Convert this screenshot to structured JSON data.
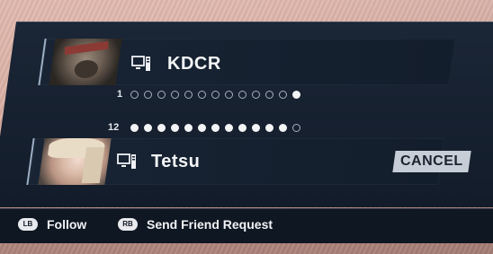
{
  "players": [
    {
      "name": "KDCR",
      "slot_number": "1",
      "avatar": "bear-character"
    },
    {
      "name": "Tetsu",
      "slot_number": "12",
      "avatar": "blonde-character"
    }
  ],
  "progress": {
    "top": {
      "total": 13,
      "filled_index": 13
    },
    "bottom": {
      "total": 13,
      "filled_count": 12
    }
  },
  "cancel_label": "CANCEL",
  "footer": {
    "lb_badge": "LB",
    "lb_label": "Follow",
    "rb_badge": "RB",
    "rb_label": "Send Friend Request"
  },
  "icons": {
    "platform": "pc-icon"
  }
}
